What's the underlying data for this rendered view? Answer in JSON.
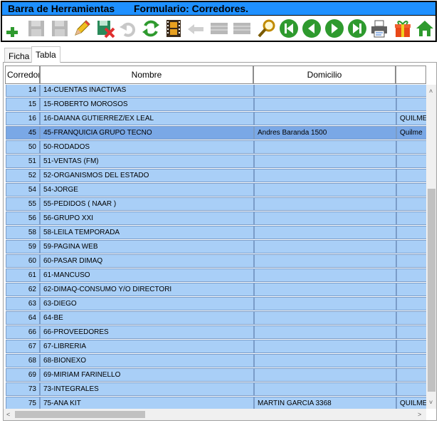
{
  "titlebar": {
    "app": "Barra de Herramientas",
    "form": "Formulario: Corredores."
  },
  "toolbar": {
    "buttons": [
      {
        "name": "add-icon",
        "enabled": true
      },
      {
        "name": "save-icon",
        "enabled": false
      },
      {
        "name": "save-as-icon",
        "enabled": false
      },
      {
        "name": "edit-pencil-icon",
        "enabled": true
      },
      {
        "name": "delete-icon",
        "enabled": true
      },
      {
        "name": "undo-icon",
        "enabled": false
      },
      {
        "name": "refresh-icon",
        "enabled": true
      },
      {
        "name": "film-icon",
        "enabled": true
      },
      {
        "name": "back-arrow-icon",
        "enabled": false
      },
      {
        "name": "grid-icon",
        "enabled": false
      },
      {
        "name": "grid2-icon",
        "enabled": false
      },
      {
        "name": "search-icon",
        "enabled": true
      },
      {
        "name": "first-record-icon",
        "enabled": true
      },
      {
        "name": "previous-record-icon",
        "enabled": true
      },
      {
        "name": "next-record-icon",
        "enabled": true
      },
      {
        "name": "last-record-icon",
        "enabled": true
      },
      {
        "name": "print-icon",
        "enabled": true
      },
      {
        "name": "gift-icon",
        "enabled": true
      },
      {
        "name": "home-icon",
        "enabled": true
      }
    ]
  },
  "tabs": {
    "ficha": "Ficha",
    "tabla": "Tabla"
  },
  "grid": {
    "headers": [
      "Corredor",
      "Nombre",
      "Domicilio",
      ""
    ],
    "rows": [
      {
        "id": "14",
        "nombre": "14-CUENTAS INACTIVAS",
        "domicilio": "",
        "extra": ""
      },
      {
        "id": "15",
        "nombre": "15-ROBERTO MOROSOS",
        "domicilio": "",
        "extra": ""
      },
      {
        "id": "16",
        "nombre": "16-DAIANA GUTIERREZ/EX LEAL",
        "domicilio": "",
        "extra": "QUILME"
      },
      {
        "id": "45",
        "nombre": "45-FRANQUICIA GRUPO TECNO",
        "domicilio": "Andres Baranda 1500",
        "extra": "Quilme"
      },
      {
        "id": "50",
        "nombre": "50-RODADOS",
        "domicilio": "",
        "extra": ""
      },
      {
        "id": "51",
        "nombre": "51-VENTAS (FM)",
        "domicilio": "",
        "extra": ""
      },
      {
        "id": "52",
        "nombre": "52-ORGANISMOS DEL ESTADO",
        "domicilio": "",
        "extra": ""
      },
      {
        "id": "54",
        "nombre": "54-JORGE",
        "domicilio": "",
        "extra": ""
      },
      {
        "id": "55",
        "nombre": "55-PEDIDOS ( NAAR )",
        "domicilio": "",
        "extra": ""
      },
      {
        "id": "56",
        "nombre": "56-GRUPO XXI",
        "domicilio": "",
        "extra": ""
      },
      {
        "id": "58",
        "nombre": "58-LEILA TEMPORADA",
        "domicilio": "",
        "extra": ""
      },
      {
        "id": "59",
        "nombre": "59-PAGINA WEB",
        "domicilio": "",
        "extra": ""
      },
      {
        "id": "60",
        "nombre": "60-PASAR DIMAQ",
        "domicilio": "",
        "extra": ""
      },
      {
        "id": "61",
        "nombre": "61-MANCUSO",
        "domicilio": "",
        "extra": ""
      },
      {
        "id": "62",
        "nombre": "62-DIMAQ-CONSUMO Y/O DIRECTORI",
        "domicilio": "",
        "extra": ""
      },
      {
        "id": "63",
        "nombre": "63-DIEGO",
        "domicilio": "",
        "extra": ""
      },
      {
        "id": "64",
        "nombre": "64-BE",
        "domicilio": "",
        "extra": ""
      },
      {
        "id": "66",
        "nombre": "66-PROVEEDORES",
        "domicilio": "",
        "extra": ""
      },
      {
        "id": "67",
        "nombre": "67-LIBRERIA",
        "domicilio": "",
        "extra": ""
      },
      {
        "id": "68",
        "nombre": "68-BIONEXO",
        "domicilio": "",
        "extra": ""
      },
      {
        "id": "69",
        "nombre": "69-MIRIAM FARINELLO",
        "domicilio": "",
        "extra": ""
      },
      {
        "id": "73",
        "nombre": "73-INTEGRALES",
        "domicilio": "",
        "extra": ""
      },
      {
        "id": "75",
        "nombre": "75-ANA KIT",
        "domicilio": "MARTIN GARCIA 3368",
        "extra": "QUILME"
      }
    ],
    "selected_id": "45"
  },
  "colors": {
    "title_bg": "#1e90ff",
    "row_bg": "#a9cff7",
    "row_selected_bg": "#7aa8e6"
  }
}
